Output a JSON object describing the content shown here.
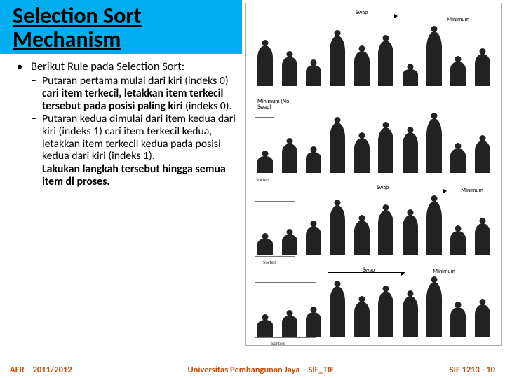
{
  "title": "Selection Sort Mechanism",
  "bullet": "Berikut Rule pada Selection Sort:",
  "sub1_a": "Putaran pertama mulai dari kiri (indeks 0) ",
  "sub1_b": "cari item terkecil, letakkan item terkecil tersebut pada posisi paling kiri",
  "sub1_c": " (indeks 0).",
  "sub2": "Putaran kedua dimulai dari item kedua dari kiri (indeks 1) cari item terkecil kedua, letakkan item terkecil kedua pada posisi kedua dari kiri (indeks 1).",
  "sub3_a": "Lakukan langkah tersebut hingga semua item di proses.",
  "footer_left": "AER – 2011/2012",
  "footer_center": "Universitas Pembangunan Jaya – SIF_TIF",
  "footer_right": "SIF 1213 - 10",
  "illus": {
    "swap": "Swap",
    "minimum": "Minimum",
    "min_noswap": "Minimum (No Swap)",
    "sorted": "Sorted",
    "heights": [
      58,
      42,
      30,
      72,
      50,
      65,
      24,
      78,
      35,
      46
    ]
  }
}
